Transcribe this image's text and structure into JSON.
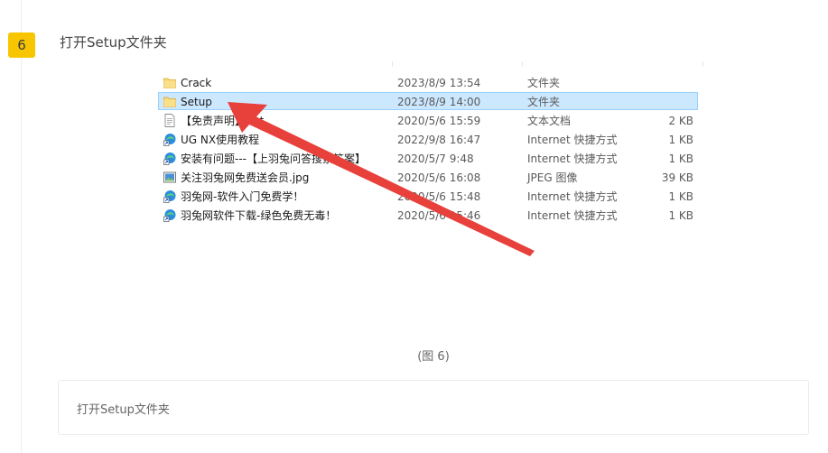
{
  "step": {
    "number": "6",
    "title": "打开Setup文件夹"
  },
  "explorer": {
    "files": [
      {
        "name": "Crack",
        "date": "2023/8/9 13:54",
        "type": "文件夹",
        "size": "",
        "icon": "folder-icon",
        "selected": false
      },
      {
        "name": "Setup",
        "date": "2023/8/9 14:00",
        "type": "文件夹",
        "size": "",
        "icon": "folder-icon",
        "selected": true
      },
      {
        "name": "【免责声明】.txt",
        "date": "2020/5/6 15:59",
        "type": "文本文档",
        "size": "2 KB",
        "icon": "text-file-icon",
        "selected": false
      },
      {
        "name": "UG NX使用教程",
        "date": "2022/9/8 16:47",
        "type": "Internet 快捷方式",
        "size": "1 KB",
        "icon": "internet-shortcut-icon",
        "selected": false
      },
      {
        "name": "安装有问题---【上羽兔问答搜索答案】",
        "date": "2020/5/7 9:48",
        "type": "Internet 快捷方式",
        "size": "1 KB",
        "icon": "internet-shortcut-icon",
        "selected": false
      },
      {
        "name": "关注羽兔网免费送会员.jpg",
        "date": "2020/5/6 16:08",
        "type": "JPEG 图像",
        "size": "39 KB",
        "icon": "image-file-icon",
        "selected": false
      },
      {
        "name": "羽兔网-软件入门免费学！",
        "date": "2020/5/6 15:48",
        "type": "Internet 快捷方式",
        "size": "1 KB",
        "icon": "internet-shortcut-icon",
        "selected": false
      },
      {
        "name": "羽兔网软件下载-绿色免费无毒！",
        "date": "2020/5/6 15:46",
        "type": "Internet 快捷方式",
        "size": "1 KB",
        "icon": "internet-shortcut-icon",
        "selected": false
      }
    ]
  },
  "annotation_color": "#e8403a",
  "caption": "(图 6)",
  "note": {
    "text": "打开Setup文件夹"
  }
}
